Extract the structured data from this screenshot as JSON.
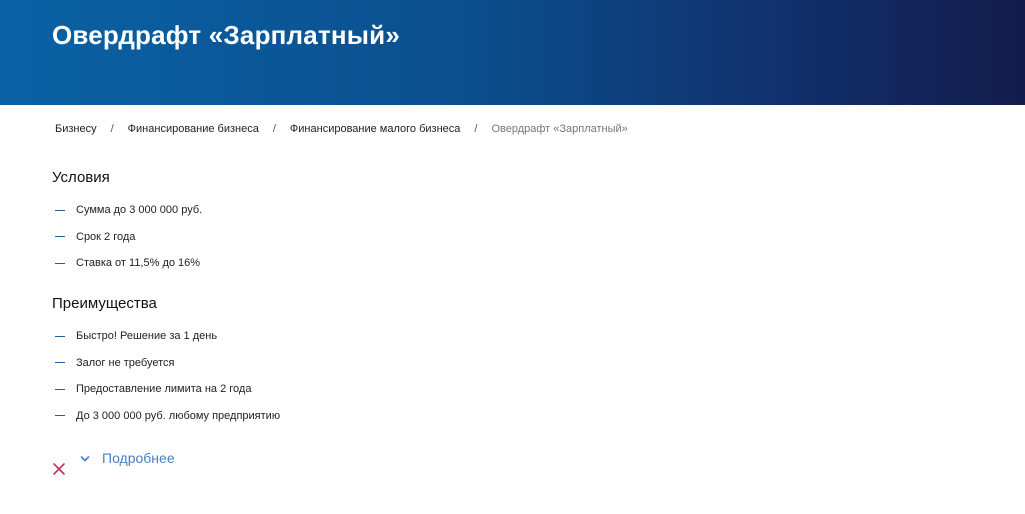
{
  "header": {
    "title": "Овердрафт «Зарплатный»"
  },
  "breadcrumb": {
    "items": [
      {
        "label": "Бизнесу"
      },
      {
        "label": "Финансирование бизнеса"
      },
      {
        "label": "Финансирование малого бизнеса"
      },
      {
        "label": "Овердрафт «Зарплатный»"
      }
    ],
    "separator": "/"
  },
  "conditions": {
    "title": "Условия",
    "items": [
      "Сумма до 3 000 000 руб.",
      "Срок 2 года",
      "Ставка от 11,5% до 16%"
    ]
  },
  "advantages": {
    "title": "Преимущества",
    "items": [
      "Быстро! Решение за 1 день",
      "Залог не требуется",
      "Предоставление лимита на 2 года",
      "До 3 000 000 руб. любому предприятию"
    ]
  },
  "more": {
    "label": "Подробнее"
  },
  "icons": {
    "close": "close-icon",
    "chevron": "chevron-down-icon"
  },
  "colors": {
    "header_start": "#0a62a4",
    "header_end": "#131c4c",
    "accent": "#1f5fa0",
    "link": "#4a7fc0",
    "close": "#c0325a"
  }
}
